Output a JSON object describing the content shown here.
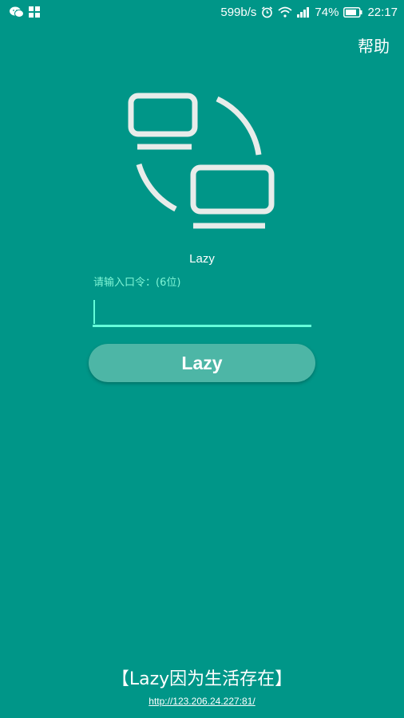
{
  "status_bar": {
    "speed": "599b/s",
    "battery": "74%",
    "time": "22:17",
    "icons": [
      "wechat-icon",
      "app-grid-icon",
      "alarm-icon",
      "wifi-icon",
      "signal-icon",
      "battery-icon"
    ]
  },
  "header": {
    "help_label": "帮助"
  },
  "app": {
    "name": "Lazy"
  },
  "form": {
    "label": "请输入口令：(6位)",
    "value": "",
    "button_label": "Lazy"
  },
  "footer": {
    "slogan": "【Lazy因为生活存在】",
    "link": "http://123.206.24.227:81/"
  },
  "colors": {
    "background": "#009688",
    "accent": "#64ffda",
    "button": "#4db6a6"
  }
}
